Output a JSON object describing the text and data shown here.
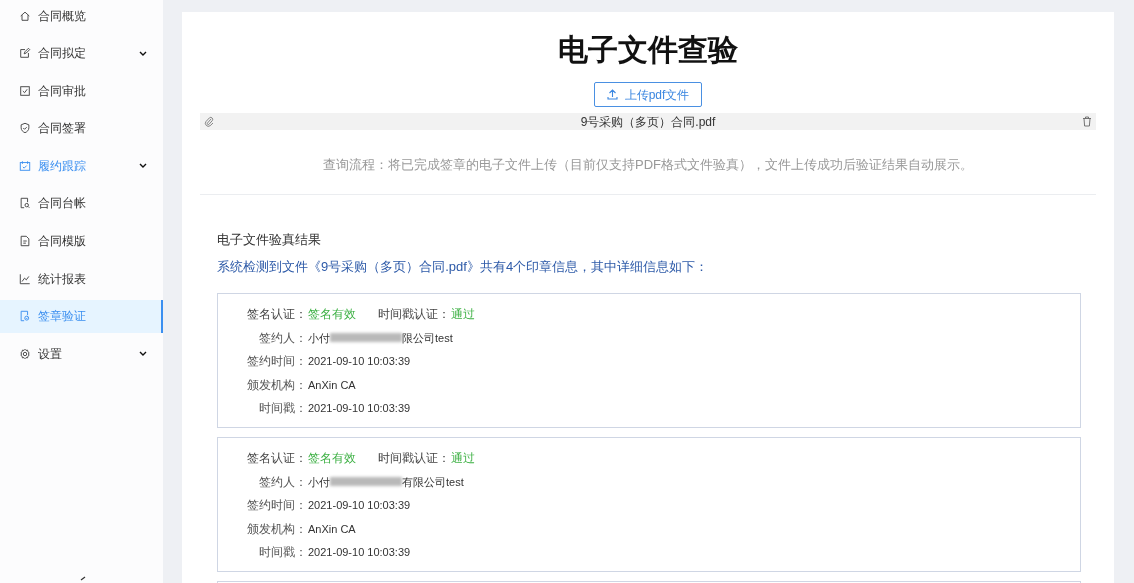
{
  "sidebar": {
    "items": [
      {
        "label": "合同概览",
        "kind": "home",
        "selected": false,
        "highlighted": false,
        "has_children": false
      },
      {
        "label": "合同拟定",
        "kind": "edit",
        "selected": false,
        "highlighted": false,
        "has_children": true
      },
      {
        "label": "合同审批",
        "kind": "check",
        "selected": false,
        "highlighted": false,
        "has_children": false
      },
      {
        "label": "合同签署",
        "kind": "shield",
        "selected": false,
        "highlighted": false,
        "has_children": false
      },
      {
        "label": "履约跟踪",
        "kind": "calendar",
        "selected": false,
        "highlighted": true,
        "has_children": true
      },
      {
        "label": "合同台帐",
        "kind": "doc-search",
        "selected": false,
        "highlighted": false,
        "has_children": false
      },
      {
        "label": "合同模版",
        "kind": "doc",
        "selected": false,
        "highlighted": false,
        "has_children": false
      },
      {
        "label": "统计报表",
        "kind": "chart",
        "selected": false,
        "highlighted": false,
        "has_children": false
      },
      {
        "label": "签章验证",
        "kind": "doc-check",
        "selected": true,
        "highlighted": true,
        "has_children": false
      },
      {
        "label": "设置",
        "kind": "gear",
        "selected": false,
        "highlighted": false,
        "has_children": true
      }
    ]
  },
  "page": {
    "title": "电子文件查验",
    "upload_button": "上传pdf文件",
    "file_name": "9号采购（多页）合同.pdf",
    "hint": "查询流程：将已完成签章的电子文件上传（目前仅支持PDF格式文件验真），文件上传成功后验证结果自动展示。"
  },
  "result": {
    "title": "电子文件验真结果",
    "summary": "系统检测到文件《9号采购（多页）合同.pdf》共有4个印章信息，其中详细信息如下：",
    "records": [
      {
        "sign_label": "签名认证：",
        "sign_status": "签名有效",
        "ts_label": "时间戳认证：",
        "ts_status": "通过",
        "fields": [
          {
            "label": "签约人：",
            "value_start": "小付",
            "value_end": "限公司test",
            "redacted": true
          },
          {
            "label": "签约时间：",
            "value_start": "2021-09-10 10:03:39",
            "redacted": false
          },
          {
            "label": "颁发机构：",
            "value_start": "AnXin CA",
            "redacted": false
          },
          {
            "label": "时间戳：",
            "value_start": "2021-09-10 10:03:39",
            "redacted": false
          }
        ]
      },
      {
        "sign_label": "签名认证：",
        "sign_status": "签名有效",
        "ts_label": "时间戳认证：",
        "ts_status": "通过",
        "fields": [
          {
            "label": "签约人：",
            "value_start": "小付",
            "value_end": "有限公司test",
            "redacted": true
          },
          {
            "label": "签约时间：",
            "value_start": "2021-09-10 10:03:39",
            "redacted": false
          },
          {
            "label": "颁发机构：",
            "value_start": "AnXin CA",
            "redacted": false
          },
          {
            "label": "时间戳：",
            "value_start": "2021-09-10 10:03:39",
            "redacted": false
          }
        ]
      }
    ]
  }
}
